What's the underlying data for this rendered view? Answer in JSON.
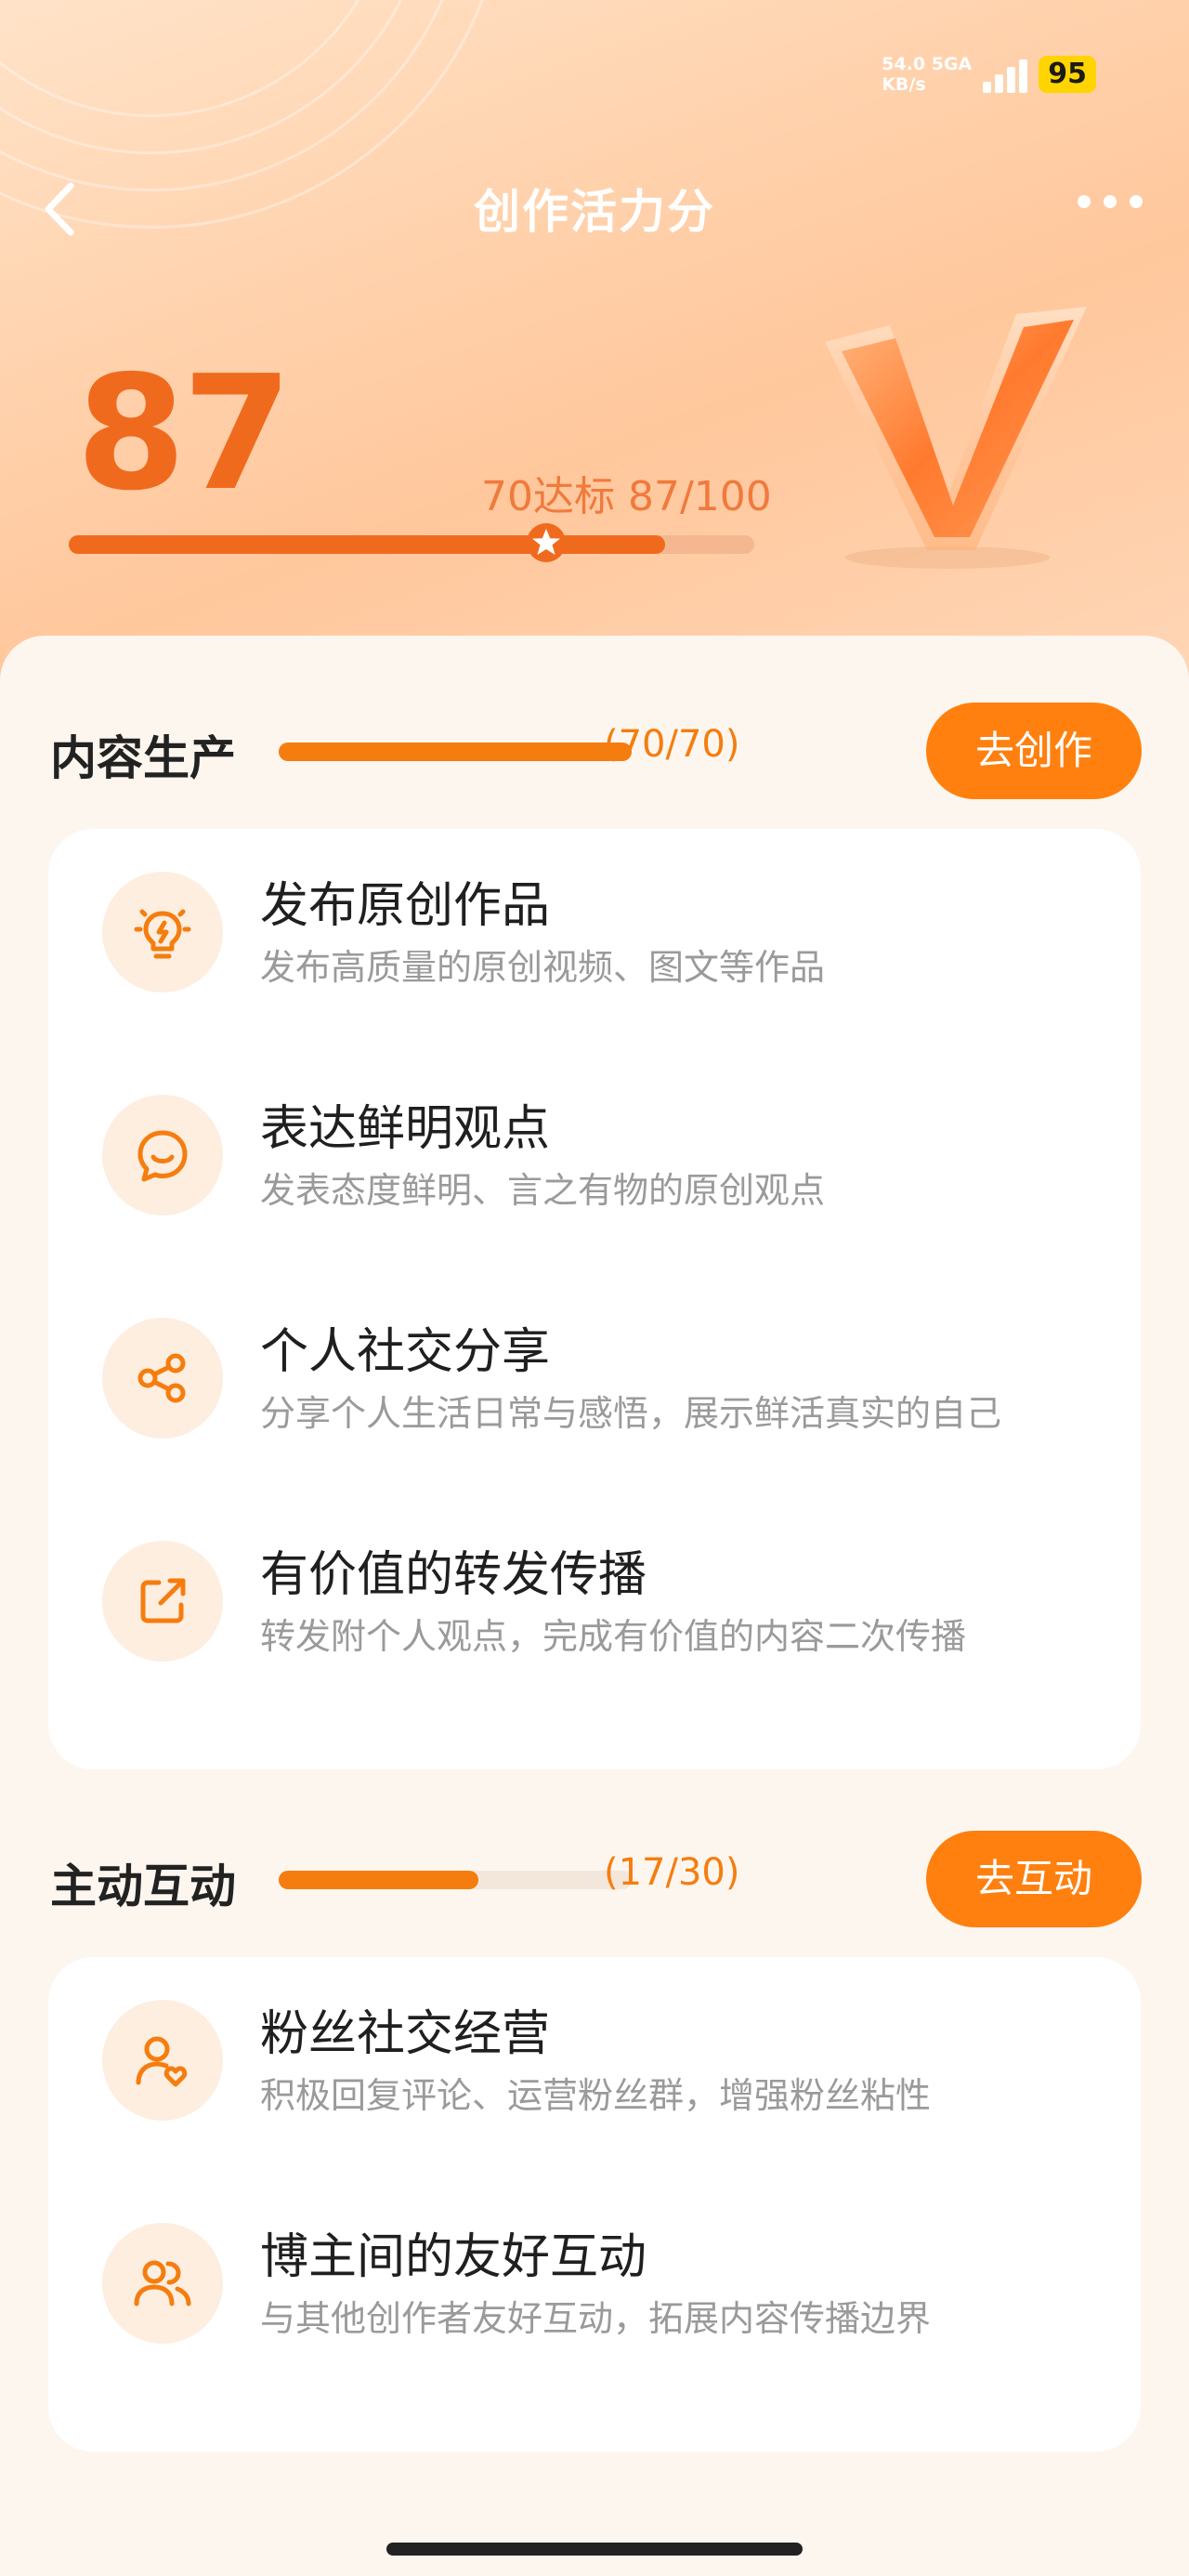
{
  "status_bar": {
    "net_speed_value": "54.0",
    "net_speed_unit": "KB/s",
    "network": "5GA",
    "battery": "95"
  },
  "header": {
    "title": "创作活力分"
  },
  "score": {
    "value": "87",
    "meta": "70达标 87/100",
    "current": 87,
    "max": 100,
    "threshold": 70
  },
  "sections": [
    {
      "title": "内容生产",
      "count": "(70/70)",
      "progress": 70,
      "progress_max": 70,
      "action": "去创作",
      "items": [
        {
          "icon": "lightbulb-icon",
          "title": "发布原创作品",
          "desc": "发布高质量的原创视频、图文等作品"
        },
        {
          "icon": "chat-smile-icon",
          "title": "表达鲜明观点",
          "desc": "发表态度鲜明、言之有物的原创观点"
        },
        {
          "icon": "share-icon",
          "title": "个人社交分享",
          "desc": "分享个人生活日常与感悟，展示鲜活真实的自己"
        },
        {
          "icon": "forward-icon",
          "title": "有价值的转发传播",
          "desc": "转发附个人观点，完成有价值的内容二次传播"
        }
      ]
    },
    {
      "title": "主动互动",
      "count": "(17/30)",
      "progress": 17,
      "progress_max": 30,
      "action": "去互动",
      "items": [
        {
          "icon": "fan-heart-icon",
          "title": "粉丝社交经营",
          "desc": "积极回复评论、运营粉丝群，增强粉丝粘性"
        },
        {
          "icon": "users-icon",
          "title": "博主间的友好互动",
          "desc": "与其他创作者友好互动，拓展内容传播边界"
        }
      ]
    }
  ],
  "colors": {
    "accent": "#ff800f",
    "score": "#f06a1e",
    "icon_bg": "#fdeee0"
  }
}
